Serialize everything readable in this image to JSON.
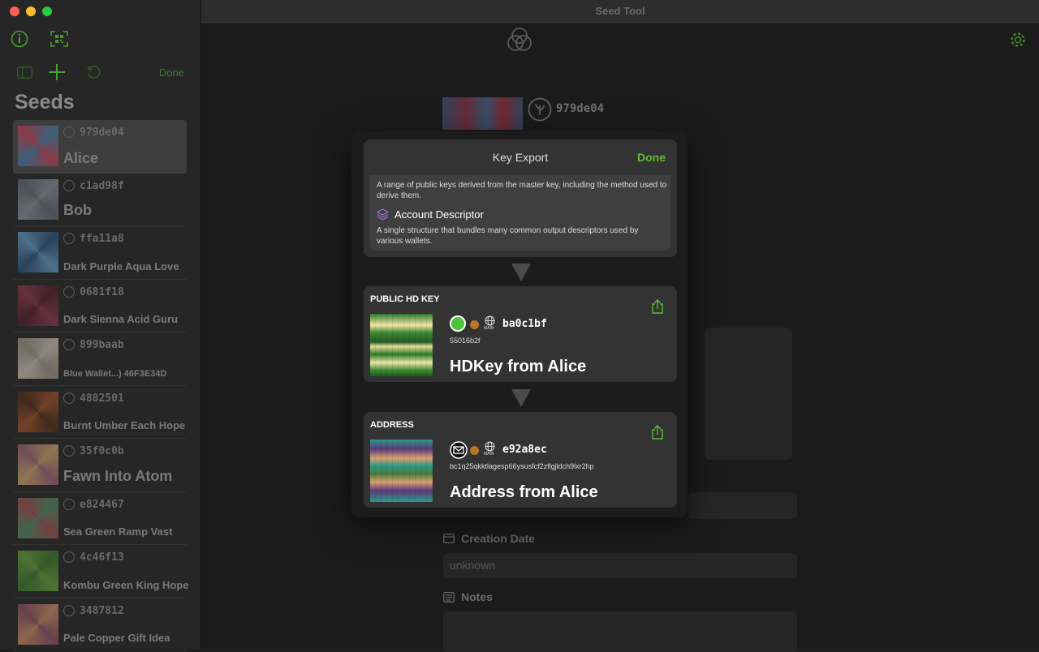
{
  "window": {
    "title": "Seed Tool"
  },
  "sidebar": {
    "done_label": "Done",
    "heading": "Seeds",
    "seeds": [
      {
        "id": "979de04",
        "name": "Alice",
        "selected": true,
        "colors": [
          "#3d6b8f",
          "#a23b4a"
        ]
      },
      {
        "id": "c1ad98f",
        "name": "Bob",
        "colors": [
          "#7a8088",
          "#5a6068"
        ]
      },
      {
        "id": "ffa11a8",
        "name": "Dark Purple Aqua Love",
        "colors": [
          "#2c4a6e",
          "#5a87a8"
        ]
      },
      {
        "id": "0681f18",
        "name": "Dark Sienna Acid Guru",
        "colors": [
          "#4a1e2a",
          "#7a3546"
        ]
      },
      {
        "id": "899baab",
        "name": "Blue Wallet...) 46F3E34D",
        "colors": [
          "#b2a89a",
          "#8a8276"
        ]
      },
      {
        "id": "4882501",
        "name": "Burnt Umber Each Hope",
        "colors": [
          "#8a4a2a",
          "#4a2a1a"
        ]
      },
      {
        "id": "35f0c0b",
        "name": "Fawn Into Atom",
        "colors": [
          "#b09060",
          "#8a5a6a"
        ]
      },
      {
        "id": "e824467",
        "name": "Sea Green Ramp Vast",
        "colors": [
          "#4a7a5a",
          "#8a4a4a"
        ]
      },
      {
        "id": "4c46f13",
        "name": "Kombu Green King Hope",
        "colors": [
          "#3a6a2a",
          "#5a8a3a"
        ]
      },
      {
        "id": "3487812",
        "name": "Pale Copper Gift Idea",
        "colors": [
          "#b07a5a",
          "#7a4a5a"
        ]
      }
    ]
  },
  "main": {
    "seed_id": "979de04",
    "creation_date_label": "Creation Date",
    "creation_date_value": "unknown",
    "notes_label": "Notes"
  },
  "modal": {
    "title": "Key Export",
    "done_label": "Done",
    "options_card": {
      "first_desc": "A range of public keys derived from the master key, including the method used to derive them.",
      "account_descriptor_title": "Account Descriptor",
      "account_descriptor_desc": "A single structure that bundles many common output descriptors used by various wallets."
    },
    "public_hd_key": {
      "section_title": "PUBLIC HD KEY",
      "short_id": "ba0c1bf",
      "fingerprint": "55016b2f",
      "name": "HDKey from Alice",
      "network_label": "MAIN",
      "accent_color": "#4ec23a"
    },
    "address": {
      "section_title": "ADDRESS",
      "short_id": "e92a8ec",
      "address": "bc1q25qkktlagesp66ysusfcf2zflgjldch9lxr2hp",
      "name": "Address from Alice",
      "network_label": "MAIN"
    }
  }
}
